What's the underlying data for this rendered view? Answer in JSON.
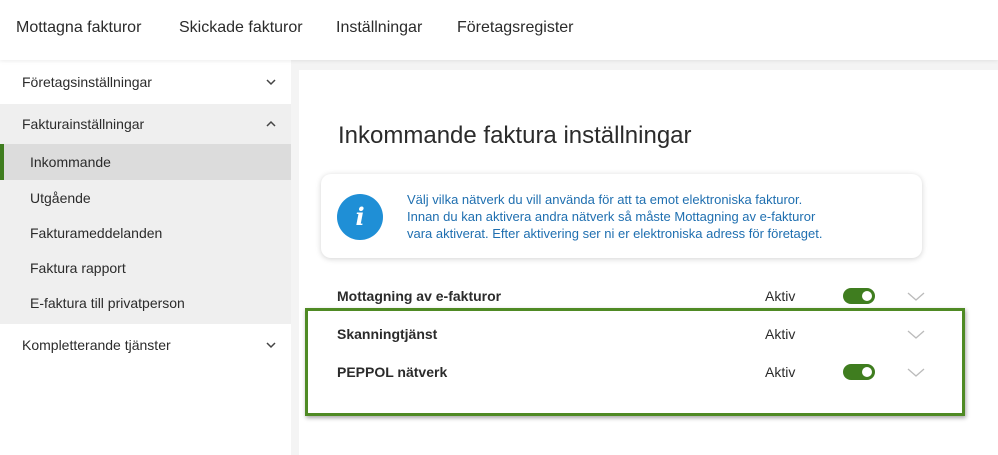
{
  "topnav": {
    "items": [
      {
        "label": "Mottagna fakturor"
      },
      {
        "label": "Skickade fakturor"
      },
      {
        "label": "Inställningar"
      },
      {
        "label": "Företagsregister"
      }
    ]
  },
  "sidebar": {
    "company_settings": "Företagsinställningar",
    "invoice_settings": "Fakturainställningar",
    "sub_items": [
      {
        "label": "Inkommande",
        "active": true
      },
      {
        "label": "Utgående"
      },
      {
        "label": "Fakturameddelanden"
      },
      {
        "label": "Faktura rapport"
      },
      {
        "label": "E-faktura till privatperson"
      }
    ],
    "complementary": "Kompletterande tjänster"
  },
  "main": {
    "title": "Inkommande faktura inställningar",
    "info_lines": [
      "Välj vilka nätverk du vill använda för att ta emot elektroniska fakturor.",
      "Innan du kan aktivera andra nätverk så måste Mottagning av e-fakturor",
      "vara aktiverat. Efter aktivering ser ni er elektroniska adress för företaget."
    ],
    "services": [
      {
        "name": "Mottagning av e-fakturor",
        "status": "Aktiv",
        "toggle_on": true
      },
      {
        "name": "Skanningtjänst",
        "status": "Aktiv",
        "toggle_on": false
      },
      {
        "name": "PEPPOL nätverk",
        "status": "Aktiv",
        "toggle_on": true
      }
    ]
  },
  "colors": {
    "accent_green": "#3f7d1f",
    "info_blue": "#1f8fd6",
    "highlight_green": "#4f8a24"
  }
}
